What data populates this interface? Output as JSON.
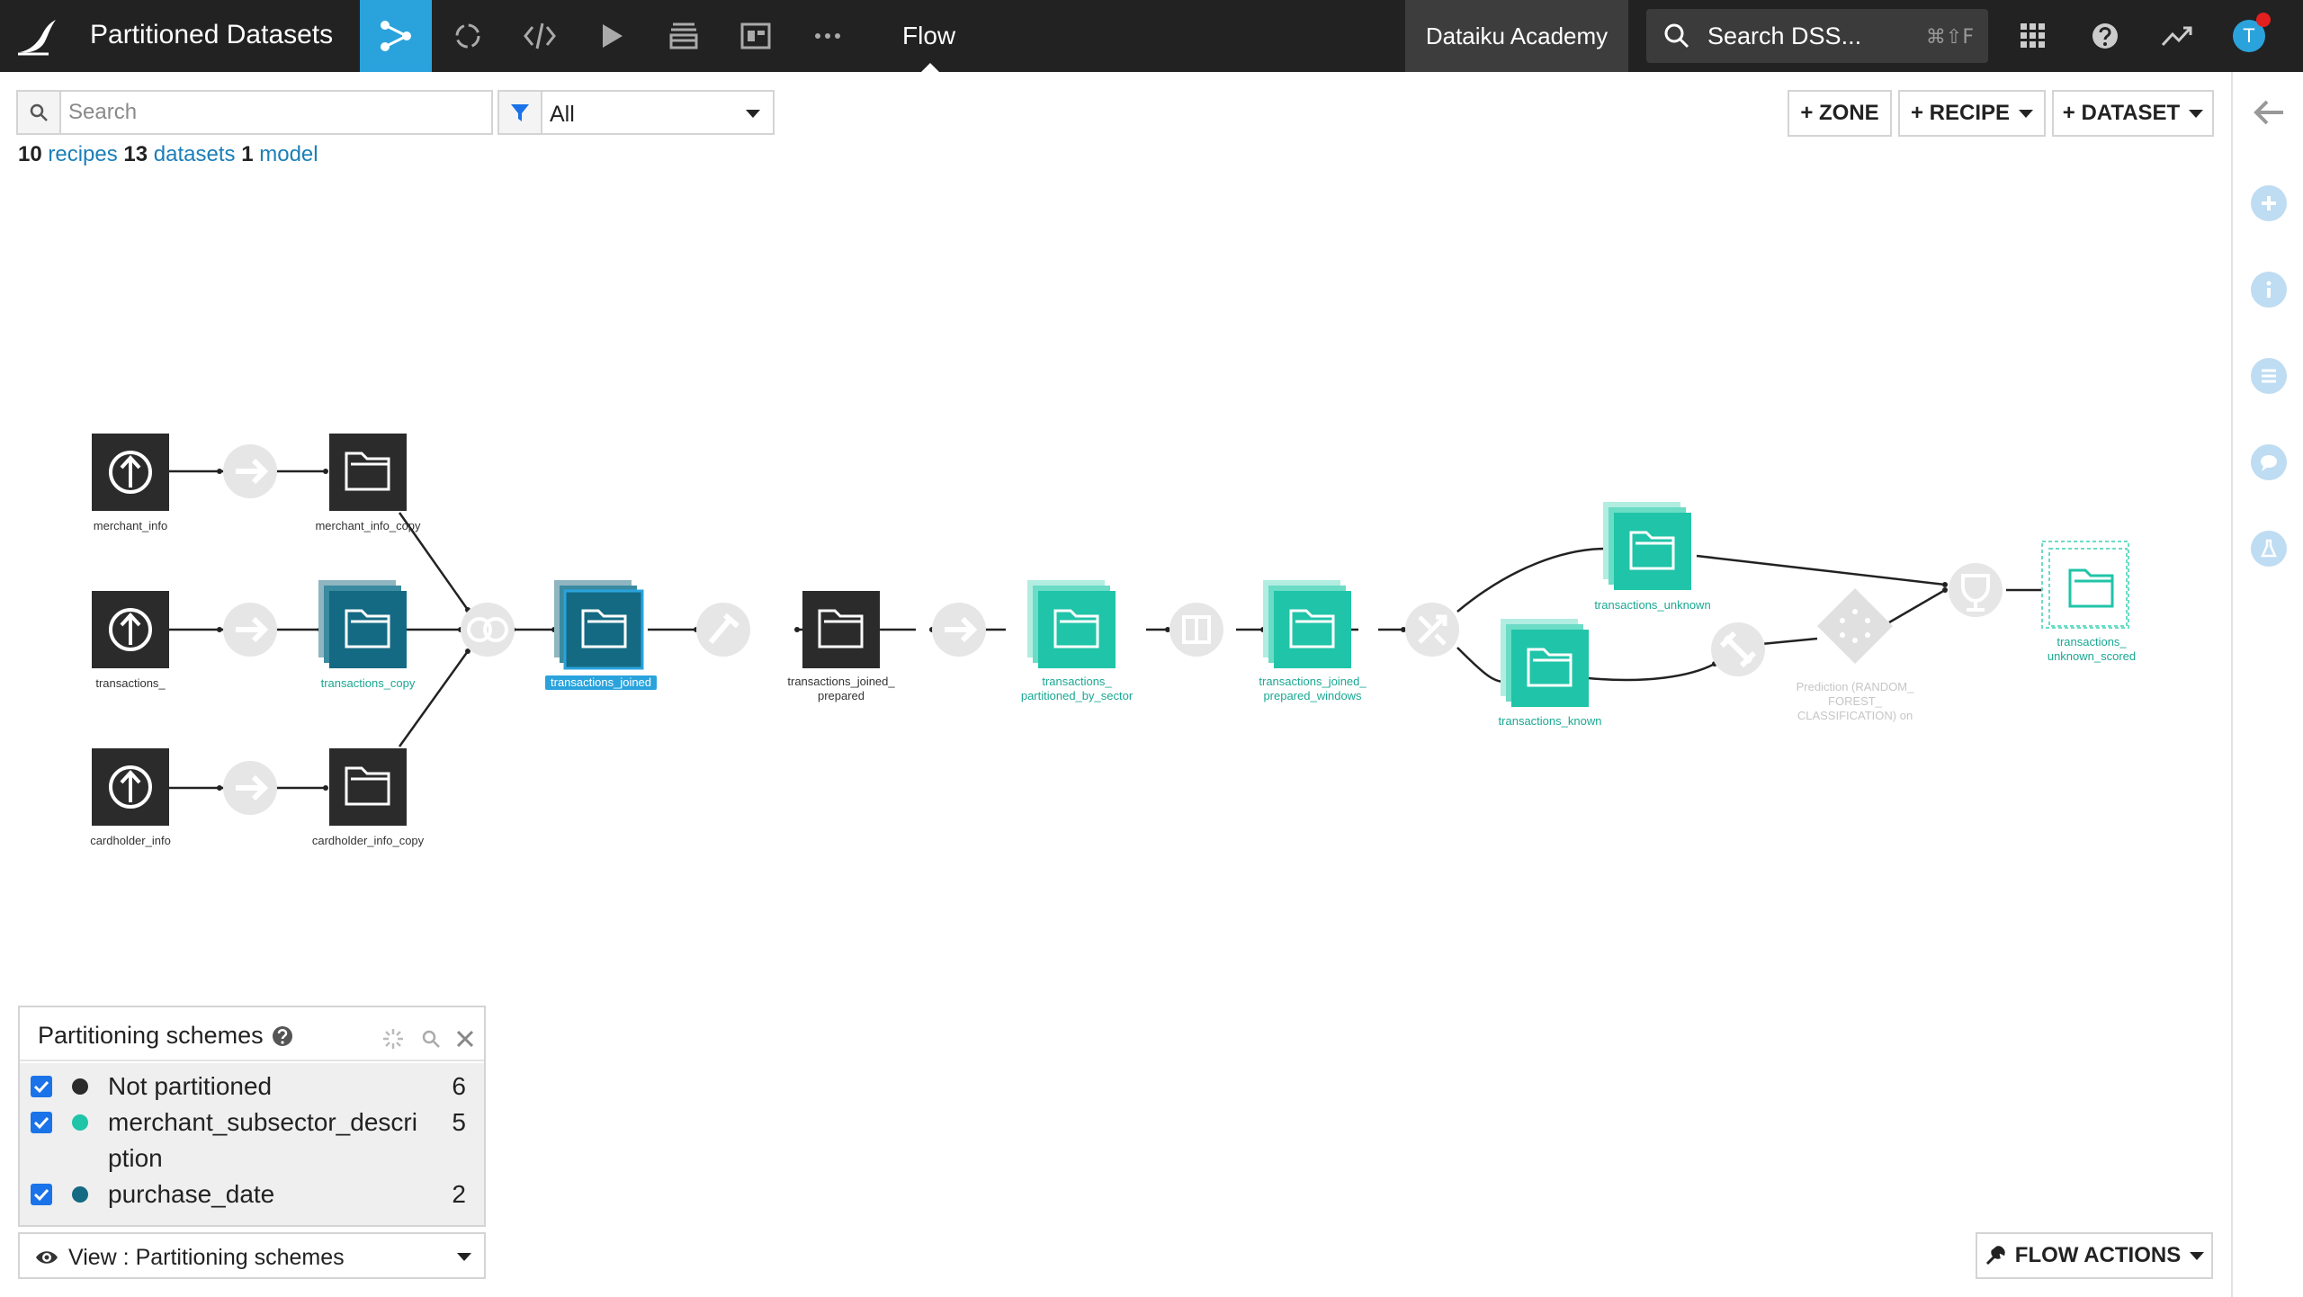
{
  "header": {
    "app_title": "Partitioned Datasets",
    "current_view": "Flow",
    "instance_name": "Dataiku Academy",
    "search_label": "Search DSS...",
    "search_shortcut": "⌘⇧F",
    "avatar_initial": "T"
  },
  "filter": {
    "search_placeholder": "Search",
    "filter_value": "All"
  },
  "counts": {
    "recipes_count": "10",
    "recipes_label": "recipes",
    "datasets_count": "13",
    "datasets_label": "datasets",
    "models_count": "1",
    "models_label": "model"
  },
  "toolbar": {
    "zone_label": "+ ZONE",
    "recipe_label": "+ RECIPE",
    "dataset_label": "+ DATASET",
    "flow_actions_label": "FLOW ACTIONS"
  },
  "flow": {
    "datasets": {
      "merchant_info": "merchant_info",
      "merchant_info_copy": "merchant_info_copy",
      "transactions": "transactions_",
      "transactions_copy": "transactions_copy",
      "cardholder_info": "cardholder_info",
      "cardholder_info_copy": "cardholder_info_copy",
      "transactions_joined": "transactions_joined",
      "transactions_joined_prepared_l1": "transactions_joined_",
      "transactions_joined_prepared_l2": "prepared",
      "partitioned_by_sector_l1": "transactions_",
      "partitioned_by_sector_l2": "partitioned_by_sector",
      "prepared_windows_l1": "transactions_joined_",
      "prepared_windows_l2": "prepared_windows",
      "transactions_unknown": "transactions_unknown",
      "transactions_known": "transactions_known",
      "unknown_scored_l1": "transactions_",
      "unknown_scored_l2": "unknown_scored"
    },
    "model_label_l1": "Prediction (RANDOM_",
    "model_label_l2": "FOREST_",
    "model_label_l3": "CLASSIFICATION) on"
  },
  "partitioning": {
    "title": "Partitioning schemes",
    "schemes": [
      {
        "label": "Not partitioned",
        "count": "6",
        "color": "#2b2b2b"
      },
      {
        "label": "merchant_subsector_description",
        "count": "5",
        "color": "#20c4a8"
      },
      {
        "label": "purchase_date",
        "count": "2",
        "color": "#146a82"
      }
    ]
  },
  "view_selector": {
    "label": "View : Partitioning schemes"
  },
  "colors": {
    "accent": "#2aa3dd",
    "dark_dataset": "#2b2b2b",
    "teal_dataset": "#20c4a8",
    "blue_dataset": "#146a82"
  }
}
